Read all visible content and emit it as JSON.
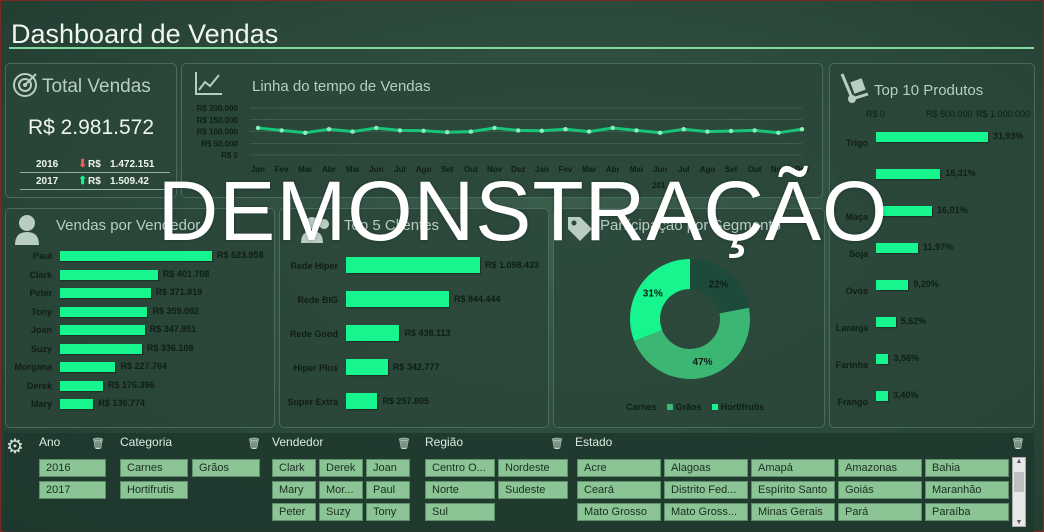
{
  "title": "Dashboard de Vendas",
  "total": {
    "label": "Total Vendas",
    "value": "R$ 2.981.572",
    "years": [
      {
        "year": "2016",
        "arrow": "down",
        "currency": "R$",
        "value": "1.472.151"
      },
      {
        "year": "2017",
        "arrow": "up",
        "currency": "R$",
        "value": "1.509.42"
      }
    ]
  },
  "timeline": {
    "label": "Linha do tempo de Vendas",
    "y_ticks": [
      "R$ 200.000",
      "R$ 150.000",
      "R$ 100.000",
      "R$ 50.000",
      "R$ 0"
    ],
    "months": [
      "Jan",
      "Fev",
      "Mar",
      "Abr",
      "Mai",
      "Jun",
      "Jul",
      "Ago",
      "Set",
      "Out",
      "Nov",
      "Dez",
      "Jan",
      "Fev",
      "Mar",
      "Abr",
      "Mai",
      "Jun",
      "Jul",
      "Ago",
      "Set",
      "Out",
      "Nov",
      "Dez"
    ],
    "year_labels": [
      "2016",
      "201"
    ]
  },
  "top10": {
    "label": "Top 10 Produtos",
    "x_ticks": [
      "R$ 0",
      "R$ 500.000",
      "R$ 1.000.000"
    ],
    "items": [
      {
        "name": "Trigo",
        "pct": "31,93%",
        "share": 31.93
      },
      {
        "name": "",
        "pct": "18,31%",
        "share": 18.31
      },
      {
        "name": "Maça",
        "pct": "16,01%",
        "share": 16.01
      },
      {
        "name": "Soja",
        "pct": "11,97%",
        "share": 11.97
      },
      {
        "name": "Ovos",
        "pct": "9,20%",
        "share": 9.2
      },
      {
        "name": "Laranja",
        "pct": "5,62%",
        "share": 5.62
      },
      {
        "name": "Farinha",
        "pct": "3,56%",
        "share": 3.56
      },
      {
        "name": "Frango",
        "pct": "3,40%",
        "share": 3.4
      }
    ]
  },
  "vendedor": {
    "label": "Vendas por Vendedor",
    "items": [
      {
        "name": "Paul",
        "value": "R$ 623.958",
        "amount": 623958
      },
      {
        "name": "Clark",
        "value": "R$ 401.708",
        "amount": 401708
      },
      {
        "name": "Peter",
        "value": "R$ 371.819",
        "amount": 371819
      },
      {
        "name": "Tony",
        "value": "R$ 359.092",
        "amount": 359092
      },
      {
        "name": "Joan",
        "value": "R$ 347.951",
        "amount": 347951
      },
      {
        "name": "Suzy",
        "value": "R$ 336.108",
        "amount": 336108
      },
      {
        "name": "Morgana",
        "value": "R$ 227.764",
        "amount": 227764
      },
      {
        "name": "Derek",
        "value": "R$ 176.396",
        "amount": 176396
      },
      {
        "name": "Mary",
        "value": "R$ 136.774",
        "amount": 136774
      }
    ]
  },
  "clientes": {
    "label": "Top 5 Clientes",
    "items": [
      {
        "name": "Rede Hiper",
        "value": "R$ 1.098.433",
        "amount": 1098433
      },
      {
        "name": "Rede BIG",
        "value": "R$ 844.444",
        "amount": 844444
      },
      {
        "name": "Rede Good",
        "value": "R$ 438.113",
        "amount": 438113
      },
      {
        "name": "Hiper Plus",
        "value": "R$ 342.777",
        "amount": 342777
      },
      {
        "name": "Super Extra",
        "value": "R$ 257.805",
        "amount": 257805
      }
    ]
  },
  "segmento": {
    "label": "Participação por Segmento",
    "slices": [
      {
        "name": "Carnes",
        "pct": "22%",
        "share": 22,
        "color": "#1e4a3c"
      },
      {
        "name": "Grãos",
        "pct": "47%",
        "share": 47,
        "color": "#3cb673"
      },
      {
        "name": "Hortifrutis",
        "pct": "31%",
        "share": 31,
        "color": "#17f58e"
      }
    ]
  },
  "slicers": {
    "ano": {
      "label": "Ano",
      "items": [
        "2016",
        "2017"
      ]
    },
    "categoria": {
      "label": "Categoria",
      "items": [
        "Carnes",
        "Grãos",
        "Hortifrutis"
      ]
    },
    "vendedor": {
      "label": "Vendedor",
      "items": [
        "Clark",
        "Derek",
        "Joan",
        "Mary",
        "Mor...",
        "Paul",
        "Peter",
        "Suzy",
        "Tony"
      ]
    },
    "regiao": {
      "label": "Região",
      "items": [
        "Centro O...",
        "Nordeste",
        "Norte",
        "Sudeste",
        "Sul"
      ]
    },
    "estado": {
      "label": "Estado",
      "items": [
        "Acre",
        "Alagoas",
        "Amapá",
        "Amazonas",
        "Bahia",
        "Ceará",
        "Distrito Fed...",
        "Espírito Santo",
        "Goiás",
        "Maranhão",
        "Mato Grosso",
        "Mato Gross...",
        "Minas Gerais",
        "Pará",
        "Paraíba"
      ]
    }
  },
  "watermark": "DEMONSTRAÇÃO",
  "colors": {
    "accent": "#17f58e",
    "background": "#2c4a3c"
  }
}
